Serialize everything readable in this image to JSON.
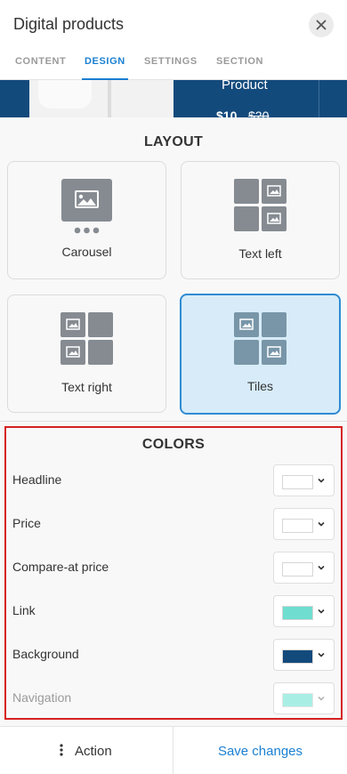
{
  "header": {
    "title": "Digital products",
    "close_icon": "close-icon"
  },
  "tabs": [
    {
      "label": "CONTENT",
      "active": false
    },
    {
      "label": "DESIGN",
      "active": true
    },
    {
      "label": "SETTINGS",
      "active": false
    },
    {
      "label": "SECTION",
      "active": false
    }
  ],
  "preview": {
    "product_name": "Product",
    "price": "$10",
    "compare_price": "$20"
  },
  "layout": {
    "title": "LAYOUT",
    "options": [
      {
        "label": "Carousel",
        "icon": "carousel-layout-icon",
        "selected": false
      },
      {
        "label": "Text left",
        "icon": "text-left-layout-icon",
        "selected": false
      },
      {
        "label": "Text right",
        "icon": "text-right-layout-icon",
        "selected": false
      },
      {
        "label": "Tiles",
        "icon": "tiles-layout-icon",
        "selected": true
      }
    ]
  },
  "colors": {
    "title": "COLORS",
    "rows": [
      {
        "label": "Headline",
        "color": "#ffffff",
        "disabled": false
      },
      {
        "label": "Price",
        "color": "#ffffff",
        "disabled": false
      },
      {
        "label": "Compare-at price",
        "color": "#ffffff",
        "disabled": false
      },
      {
        "label": "Link",
        "color": "#6fded0",
        "disabled": false
      },
      {
        "label": "Background",
        "color": "#134a7c",
        "disabled": false
      },
      {
        "label": "Navigation",
        "color": "#a9eee4",
        "disabled": true
      }
    ]
  },
  "footer": {
    "action_label": "Action",
    "save_label": "Save changes"
  },
  "theme": {
    "accent": "#1a7fd1",
    "selected_bg": "#d7ecf8",
    "highlight_border": "#d62020"
  }
}
